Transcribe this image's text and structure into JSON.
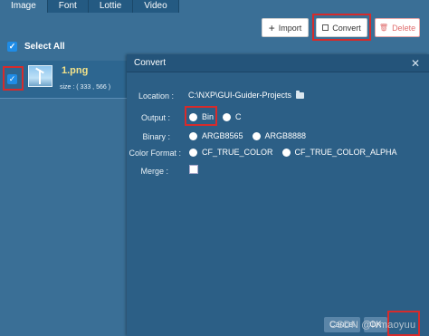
{
  "tabs": [
    "Image",
    "Font",
    "Lottie",
    "Video"
  ],
  "toolbar": {
    "import_label": "Import",
    "import_icon": "plus-icon",
    "convert_label": "Convert",
    "convert_icon": "convert-icon",
    "delete_label": "Delete",
    "delete_icon": "trash-icon"
  },
  "select_all": {
    "label": "Select All",
    "checked": true
  },
  "images": [
    {
      "name": "1.png",
      "size": "size : ( 333 , 566 )",
      "checked": true
    }
  ],
  "dialog": {
    "title": "Convert",
    "close_glyph": "✕",
    "location_label": "Location :",
    "location_value": "C:\\NXP\\GUI-Guider-Projects",
    "output_label": "Output :",
    "output_options": [
      "Bin",
      "C"
    ],
    "output_selected": "Bin",
    "binary_label": "Binary :",
    "binary_options": [
      "ARGB8565",
      "ARGB8888"
    ],
    "color_label": "Color Format :",
    "color_options": [
      "CF_TRUE_COLOR",
      "CF_TRUE_COLOR_ALPHA"
    ],
    "merge_label": "Merge :",
    "cancel_label": "Cancel",
    "ok_label": "OK"
  },
  "watermark": "CSDN @lvmaoyuu",
  "colors": {
    "highlight": "#d62b2b",
    "checkbox": "#1f8ce6",
    "accent": "#3a6f96"
  }
}
